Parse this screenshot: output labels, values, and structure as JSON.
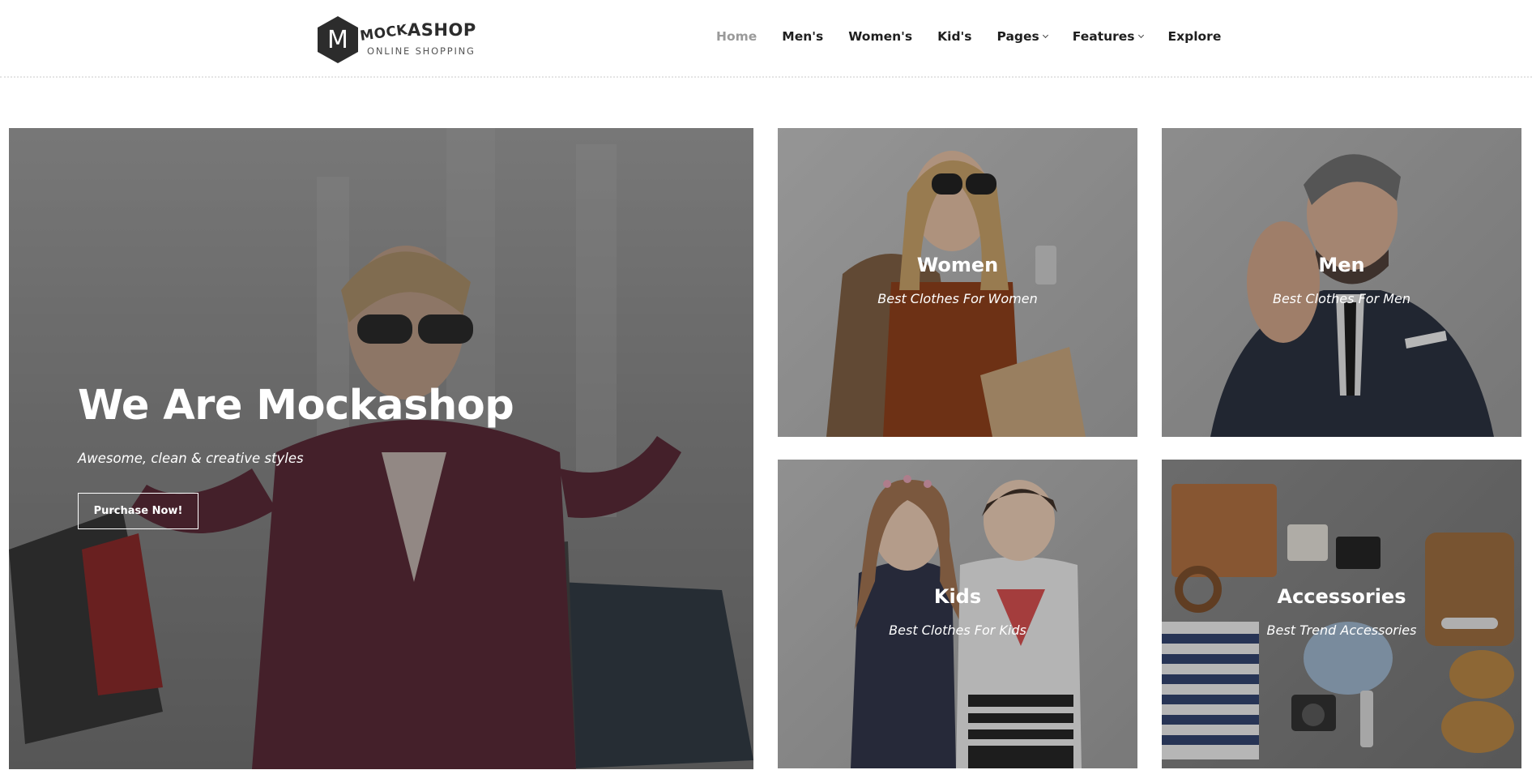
{
  "brand": {
    "letter": "M",
    "name_part1": "MOCK",
    "name_part2": "ASHOP",
    "tagline": "ONLINE SHOPPING"
  },
  "nav": {
    "items": [
      {
        "label": "Home",
        "active": true,
        "dropdown": false
      },
      {
        "label": "Men's",
        "active": false,
        "dropdown": false
      },
      {
        "label": "Women's",
        "active": false,
        "dropdown": false
      },
      {
        "label": "Kid's",
        "active": false,
        "dropdown": false
      },
      {
        "label": "Pages",
        "active": false,
        "dropdown": true
      },
      {
        "label": "Features",
        "active": false,
        "dropdown": true
      },
      {
        "label": "Explore",
        "active": false,
        "dropdown": false
      }
    ]
  },
  "hero": {
    "title": "We Are Mockashop",
    "subtitle": "Awesome, clean & creative styles",
    "button_label": "Purchase Now!"
  },
  "categories": [
    {
      "title": "Women",
      "subtitle": "Best Clothes For Women"
    },
    {
      "title": "Men",
      "subtitle": "Best Clothes For Men"
    },
    {
      "title": "Kids",
      "subtitle": "Best Clothes For Kids"
    },
    {
      "title": "Accessories",
      "subtitle": "Best Trend Accessories"
    }
  ],
  "colors": {
    "text_dark": "#1f1f1f",
    "nav_active": "#9a9a9a",
    "logo_hex": "#2c2c2c"
  }
}
